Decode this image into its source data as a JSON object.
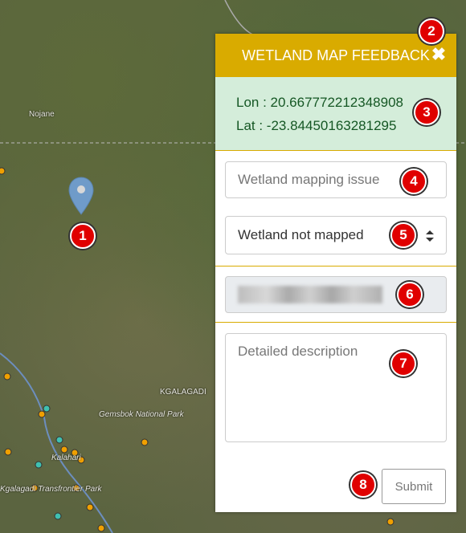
{
  "map": {
    "labels": [
      "Nojane",
      "KGALAGADI",
      "Gemsbok National Park",
      "Kalahari",
      "Kgalagadi Transfrontier Park"
    ]
  },
  "panel": {
    "title": "WETLAND MAP FEEDBACK",
    "close_icon": "close-icon",
    "lon_text": "Lon : 20.667772212348908",
    "lat_text": "Lat : -23.84450163281295",
    "issue_placeholder": "Wetland mapping issue",
    "select_value": "Wetland not mapped",
    "description_placeholder": "Detailed description",
    "submit_label": "Submit"
  },
  "badges": [
    "1",
    "2",
    "3",
    "4",
    "5",
    "6",
    "7",
    "8"
  ],
  "colors": {
    "header": "#d9ab00",
    "coords_bg": "#d4edda",
    "coords_text": "#155724",
    "badge": "#e00000"
  }
}
